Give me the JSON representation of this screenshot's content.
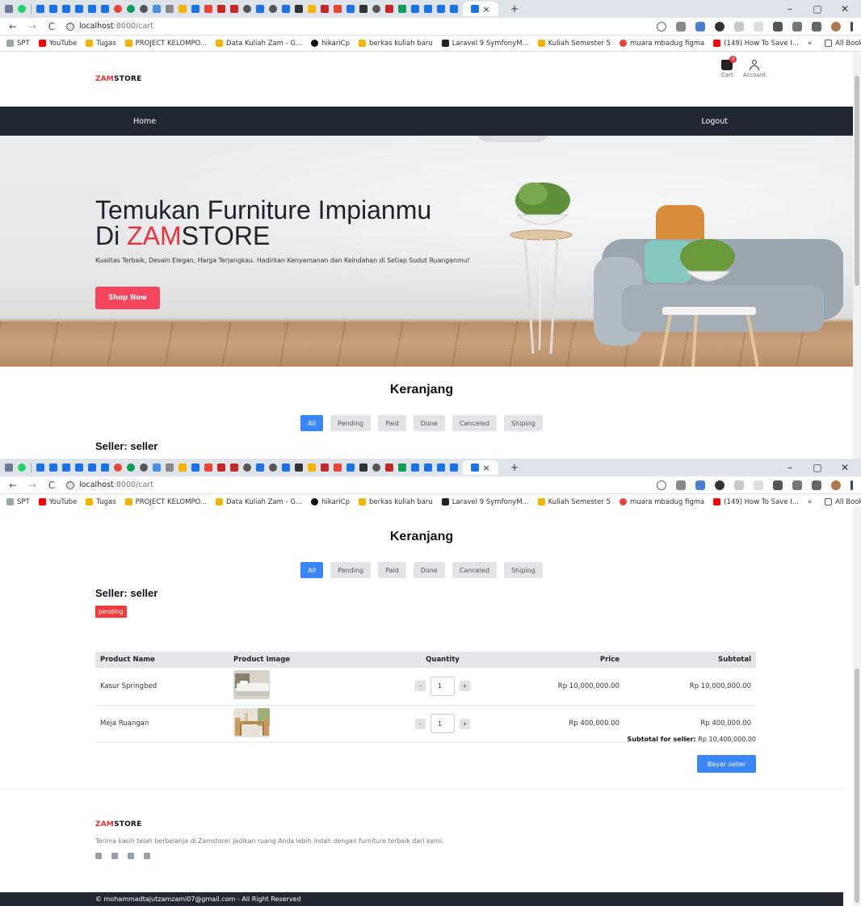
{
  "browser": {
    "url_host": "localhost",
    "url_path": ":8000/cart",
    "info_glyph": "ⓘ",
    "window_minimize": "–",
    "window_restore": "▢",
    "window_close": "✕",
    "tab_close": "×",
    "new_tab": "+",
    "nav_back": "←",
    "nav_forward": "→",
    "nav_reload": "C",
    "bookmarks": [
      "SPT",
      "YouTube",
      "Tugas",
      "PROJECT KELOMPO...",
      "Data Kuliah Zam - G...",
      "hikariCp",
      "berkas kuliah baru",
      "Laravel 9 SymfonyM...",
      "Kuliah Semester 5",
      "muara mbadug figma",
      "(149) How To Save I..."
    ],
    "bookmarks_more": "»",
    "all_bookmarks": "All Bookmarks"
  },
  "site": {
    "logo_red": "ZAM",
    "logo_dark": "STORE",
    "cart_label": "Cart",
    "cart_badge": "0",
    "account_label": "Account",
    "nav_home": "Home",
    "nav_logout": "Logout"
  },
  "hero": {
    "title_line1": "Temukan Furniture Impianmu",
    "title_line2_prefix": "Di ",
    "title_line2_red": "ZAM",
    "title_line2_dark": "STORE",
    "subtitle": "Kualitas Terbaik, Desain Elegan, Harga Terjangkau. Hadirkan Kenyamanan dan Keindahan di Setiap Sudut Ruanganmu!",
    "cta": "Shop Now"
  },
  "cart": {
    "title": "Keranjang",
    "tabs": [
      "All",
      "Pending",
      "Paid",
      "Done",
      "Canceled",
      "Shiping"
    ],
    "active_tab": "All",
    "seller_heading": "Seller: seller",
    "status": "pending",
    "columns": [
      "Product Name",
      "Product Image",
      "Quantity",
      "Price",
      "Subtotal"
    ],
    "items": [
      {
        "name": "Kasur Springbed",
        "image_icon": "bed-photo",
        "qty": "1",
        "price": "Rp 10,000,000.00",
        "subtotal": "Rp 10,000,000.00"
      },
      {
        "name": "Meja Ruangan",
        "image_icon": "dining-table-photo",
        "qty": "1",
        "price": "Rp 400,000.00",
        "subtotal": "Rp 400,000.00"
      }
    ],
    "qty_minus": "-",
    "qty_plus": "+",
    "seller_subtotal_label": "Subtotal for seller:",
    "seller_subtotal_value": " Rp 10,400,000.00",
    "pay_button": "Bayar seller"
  },
  "footer": {
    "logo_red": "ZAM",
    "logo_dark": "STORE",
    "text": "Terima kasih telah berbelanja di Zamstore! Jadikan ruang Anda lebih indah dengan furniture terbaik dari kami.",
    "socials": [
      "facebook-icon",
      "instagram-icon",
      "twitter-icon",
      "linkedin-icon"
    ],
    "copyright": "© mohammadtajutzamzami07@gmail.com - All Right Reserved"
  },
  "colors": {
    "brand_red": "#e8333c",
    "nav_dark": "#222831",
    "primary_blue": "#3a86f7",
    "cta_pink": "#f5455c"
  }
}
